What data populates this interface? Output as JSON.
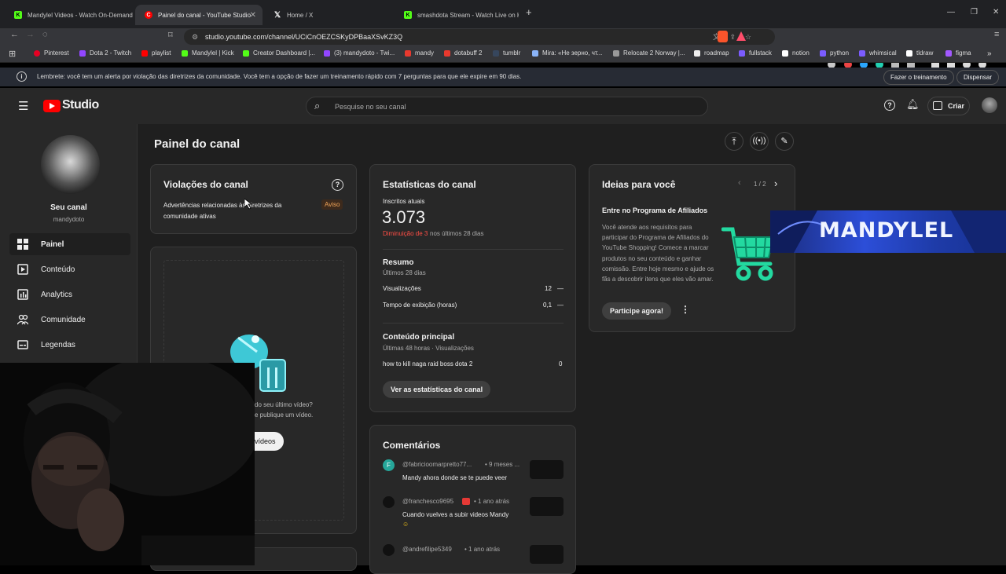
{
  "tabs": [
    {
      "title": "Mandylel Videos - Watch On-Demand",
      "icon": "kick-icon",
      "color": "#53fc18"
    },
    {
      "title": "Painel do canal - YouTube Studio",
      "icon": "youtube-studio-icon",
      "color": "#ff0000"
    },
    {
      "title": "Home / X",
      "icon": "x-icon",
      "color": "#ffffff"
    },
    {
      "title": "smashdota Stream - Watch Live on Kick",
      "icon": "kick-icon",
      "color": "#53fc18"
    }
  ],
  "address": {
    "url": "studio.youtube.com/channel/UCiCnOEZCSKyDPBaaXSvKZ3Q"
  },
  "bookmarks": [
    {
      "label": "Pinterest",
      "color": "#e60023"
    },
    {
      "label": "Dota 2 - Twitch",
      "color": "#9146ff"
    },
    {
      "label": "playlist",
      "color": "#ff0000"
    },
    {
      "label": "Mandylel | Kick",
      "color": "#53fc18"
    },
    {
      "label": "Creator Dashboard |...",
      "color": "#53fc18"
    },
    {
      "label": "(3) mandydoto - Twi...",
      "color": "#9146ff"
    },
    {
      "label": "mandy",
      "color": "#e8392e"
    },
    {
      "label": "dotabuff 2",
      "color": "#e8392e"
    },
    {
      "label": "tumblr",
      "color": "#36465d"
    },
    {
      "label": "Mira: «Не зерно, чт...",
      "color": "#8ab4f8"
    },
    {
      "label": "Relocate 2 Norway |...",
      "color": "#999999"
    },
    {
      "label": "roadmap",
      "color": "#eeeeee"
    },
    {
      "label": "fullstack",
      "color": "#7b5cff"
    },
    {
      "label": "notion",
      "color": "#ffffff"
    },
    {
      "label": "python",
      "color": "#7b5cff"
    },
    {
      "label": "whimsical",
      "color": "#7b5cff"
    },
    {
      "label": "tldraw",
      "color": "#ffffff"
    },
    {
      "label": "figma",
      "color": "#a259ff"
    }
  ],
  "alert": {
    "text": "Lembrete: você tem um alerta por violação das diretrizes da comunidade. Você tem a opção de fazer um treinamento rápido com 7 perguntas para que ele expire em 90 dias.",
    "train_button": "Fazer o treinamento",
    "dismiss_button": "Dispensar"
  },
  "header": {
    "logo": "Studio",
    "search_placeholder": "Pesquise no seu canal",
    "create_label": "Criar"
  },
  "sidebar": {
    "channel_label": "Seu canal",
    "channel_handle": "mandydoto",
    "items": [
      {
        "label": "Painel",
        "icon": "dashboard-icon"
      },
      {
        "label": "Conteúdo",
        "icon": "content-icon"
      },
      {
        "label": "Analytics",
        "icon": "analytics-icon"
      },
      {
        "label": "Comunidade",
        "icon": "community-icon"
      },
      {
        "label": "Legendas",
        "icon": "subtitles-icon"
      }
    ]
  },
  "page": {
    "title": "Painel do canal"
  },
  "violations": {
    "title": "Violações do canal",
    "text": "Advertências relacionadas às diretrizes da comunidade ativas",
    "badge": "Aviso"
  },
  "upload": {
    "line1": "do seu último vídeo?",
    "line2": "e publique um vídeo.",
    "button": "vídeos"
  },
  "stats": {
    "title": "Estatísticas do canal",
    "subs_label": "Inscritos atuais",
    "subs_value": "3.073",
    "subs_change": "Diminuição de 3",
    "subs_period": "nos últimos 28 dias",
    "summary_title": "Resumo",
    "summary_period": "Últimos 28 dias",
    "views_label": "Visualizações",
    "views_value": "12",
    "views_trend": "—",
    "watch_label": "Tempo de exibição (horas)",
    "watch_value": "0,1",
    "watch_trend": "—",
    "top_title": "Conteúdo principal",
    "top_period": "Últimas 48 horas · Visualizações",
    "top_video": "how to kill naga raid boss dota 2",
    "top_views": "0",
    "button": "Ver as estatísticas do canal"
  },
  "comments": {
    "title": "Comentários",
    "items": [
      {
        "user": "@fabricioomarpretto77...",
        "time": "• 9 meses ...",
        "text": "Mandy ahora donde se te puede veer",
        "avatar_letter": "F",
        "avatar_color": "#26a69a"
      },
      {
        "user": "@franchesco9695",
        "time": "• 1 ano atrás",
        "text": "Cuando vuelves a subir videos Mandy",
        "avatar_letter": "",
        "avatar_color": "#111111"
      },
      {
        "user": "@andrefilipe5349",
        "time": "• 1 ano atrás",
        "text": "",
        "avatar_letter": "",
        "avatar_color": "#111111"
      }
    ]
  },
  "ideas": {
    "title": "Ideias para você",
    "pager": "1 / 2",
    "subtitle": "Entre no Programa de Afiliados",
    "body": "Você atende aos requisitos para participar do Programa de Afiliados do YouTube Shopping! Comece a marcar produtos no seu conteúdo e ganhar comissão. Entre hoje mesmo e ajude os fãs a descobrir itens que eles vão amar.",
    "button": "Participe agora!"
  },
  "overlay": {
    "banner": "MANDYLEL"
  }
}
